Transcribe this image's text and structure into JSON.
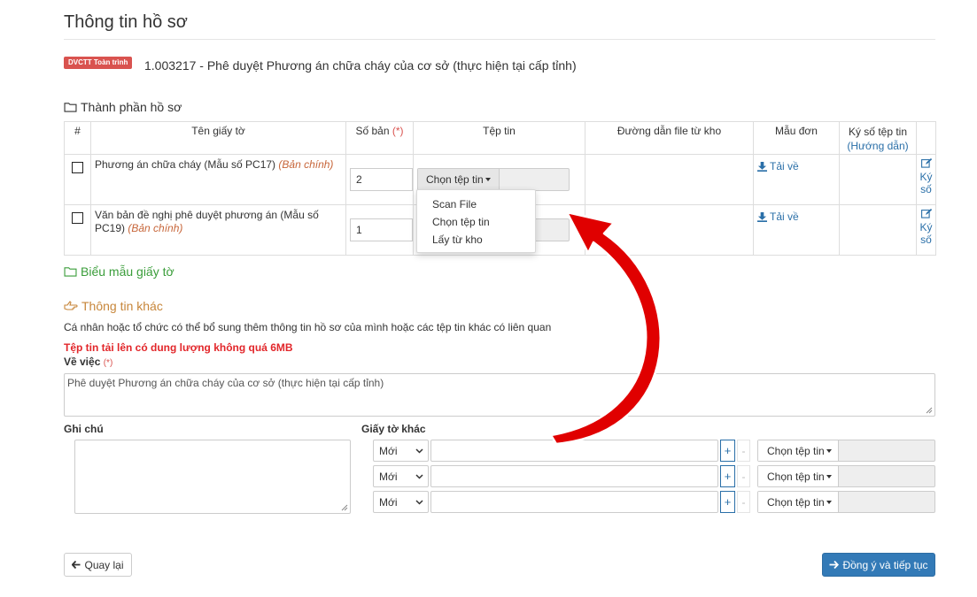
{
  "page": {
    "title": "Thông tin hồ sơ",
    "badge": "DVCTT Toàn trình",
    "procedure": "1.003217 - Phê duyệt Phương án chữa cháy của cơ sở (thực hiện tại cấp tỉnh)"
  },
  "documents_section": {
    "title": "Thành phần hồ sơ",
    "columns": {
      "index": "#",
      "name": "Tên giấy tờ",
      "copies": "Số bản",
      "required_mark": "(*)",
      "file": "Tệp tin",
      "storage_path": "Đường dẫn file từ kho",
      "form": "Mẫu đơn",
      "sign": "Ký số tệp tin",
      "sign_guide": "(Hướng dẫn)"
    },
    "rows": [
      {
        "name": "Phương án chữa cháy (Mẫu số PC17)",
        "original_tag": "(Bản chính)",
        "copies": "2",
        "file_button": "Chọn tệp tin",
        "download": "Tải về",
        "sign_line1": "Ký",
        "sign_line2": "số"
      },
      {
        "name": "Văn bản đề nghị phê duyệt phương án (Mẫu số PC19)",
        "original_tag": "(Bản chính)",
        "copies": "1",
        "download": "Tải về",
        "sign_line1": "Ký",
        "sign_line2": "số"
      }
    ],
    "file_dropdown": [
      "Scan File",
      "Chọn tệp tin",
      "Lấy từ kho"
    ]
  },
  "forms_section": {
    "title": "Biểu mẫu giấy tờ"
  },
  "other_info": {
    "title": "Thông tin khác",
    "hint": "Cá nhân hoặc tổ chức có thể bổ sung thêm thông tin hồ sơ của mình hoặc các tệp tin khác có liên quan",
    "size_warning": "Tệp tin tải lên có dung lượng không quá 6MB",
    "subject_label": "Về việc",
    "subject_required": "(*)",
    "subject_value": "Phê duyệt Phương án chữa cháy của cơ sở (thực hiện tại cấp tỉnh)",
    "note_label": "Ghi chú",
    "other_docs_label": "Giấy tờ khác",
    "other_docs_rows": [
      {
        "select": "Mới",
        "plus": "+",
        "minus": "-",
        "file_button": "Chọn tệp tin"
      },
      {
        "select": "Mới",
        "plus": "+",
        "minus": "-",
        "file_button": "Chọn tệp tin"
      },
      {
        "select": "Mới",
        "plus": "+",
        "minus": "-",
        "file_button": "Chọn tệp tin"
      }
    ]
  },
  "footer": {
    "back": "Quay lại",
    "next": "Đồng ý và tiếp tục"
  },
  "colors": {
    "badge": "#d9534f",
    "accent_blue": "#337ab7",
    "link": "#2a6fa8",
    "green_section": "#3a9d3a",
    "orange_section": "#c7863a",
    "warning": "#e2262a",
    "annotation_arrow": "#e00000"
  },
  "icons": {
    "folder": "folder-open-icon",
    "download": "download-icon",
    "sign": "edit-icon",
    "hand": "hand-point-right-icon",
    "back": "arrow-left-icon",
    "next": "arrow-right-icon",
    "caret": "caret-down-icon"
  }
}
